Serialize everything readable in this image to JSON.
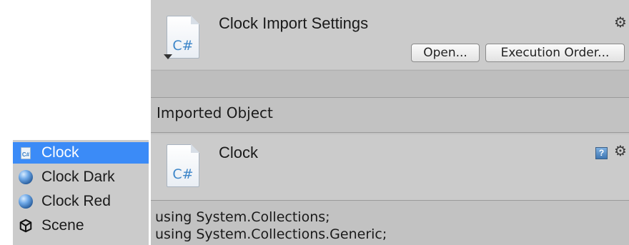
{
  "project_list": {
    "items": [
      {
        "label": "Clock",
        "icon": "csharp-file-icon",
        "selected": true
      },
      {
        "label": "Clock Dark",
        "icon": "material-sphere-icon",
        "selected": false
      },
      {
        "label": "Clock Red",
        "icon": "material-sphere-icon",
        "selected": false
      },
      {
        "label": "Scene",
        "icon": "unity-scene-icon",
        "selected": false
      }
    ]
  },
  "inspector": {
    "title": "Clock Import Settings",
    "buttons": {
      "open": "Open...",
      "execution_order": "Execution Order..."
    },
    "imported_object_label": "Imported Object",
    "object": {
      "name": "Clock",
      "icon_text": "C#"
    },
    "script_icon_text": "C#",
    "code_lines": [
      "using System.Collections;",
      "using System.Collections.Generic;"
    ]
  },
  "colors": {
    "selection": "#3b8bf7",
    "panel": "#cbcbcb",
    "cs_blue": "#3d86c9"
  }
}
